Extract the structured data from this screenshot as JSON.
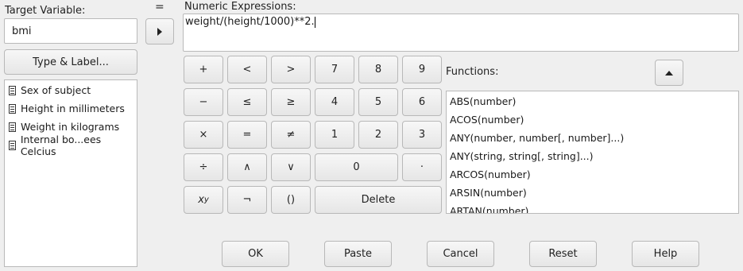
{
  "target": {
    "label": "Target Variable:",
    "value": "bmi",
    "type_label_button": "Type & Label..."
  },
  "equals_sign": "=",
  "variables": [
    "Sex of subject",
    "Height in millimeters",
    "Weight in kilograms",
    "Internal bo...ees Celcius"
  ],
  "expression": {
    "label": "Numeric Expressions:",
    "value": "weight/(height/1000)**2."
  },
  "keypad": {
    "plus": "+",
    "less": "<",
    "greater": ">",
    "seven": "7",
    "eight": "8",
    "nine": "9",
    "minus": "−",
    "lte": "≤",
    "gte": "≥",
    "four": "4",
    "five": "5",
    "six": "6",
    "times": "×",
    "eq": "=",
    "neq": "≠",
    "one": "1",
    "two": "2",
    "three": "3",
    "divide": "÷",
    "and": "∧",
    "or": "∨",
    "zero": "0",
    "dot": "·",
    "power_base": "x",
    "power_exp": "y",
    "not": "¬",
    "parens": "()",
    "delete": "Delete"
  },
  "functions": {
    "label": "Functions:",
    "items": [
      "ABS(number)",
      "ACOS(number)",
      "ANY(number, number[, number]...)",
      "ANY(string, string[, string]...)",
      "ARCOS(number)",
      "ARSIN(number)",
      "ARTAN(number)"
    ]
  },
  "buttons": {
    "ok": "OK",
    "paste": "Paste",
    "cancel": "Cancel",
    "reset": "Reset",
    "help": "Help"
  }
}
